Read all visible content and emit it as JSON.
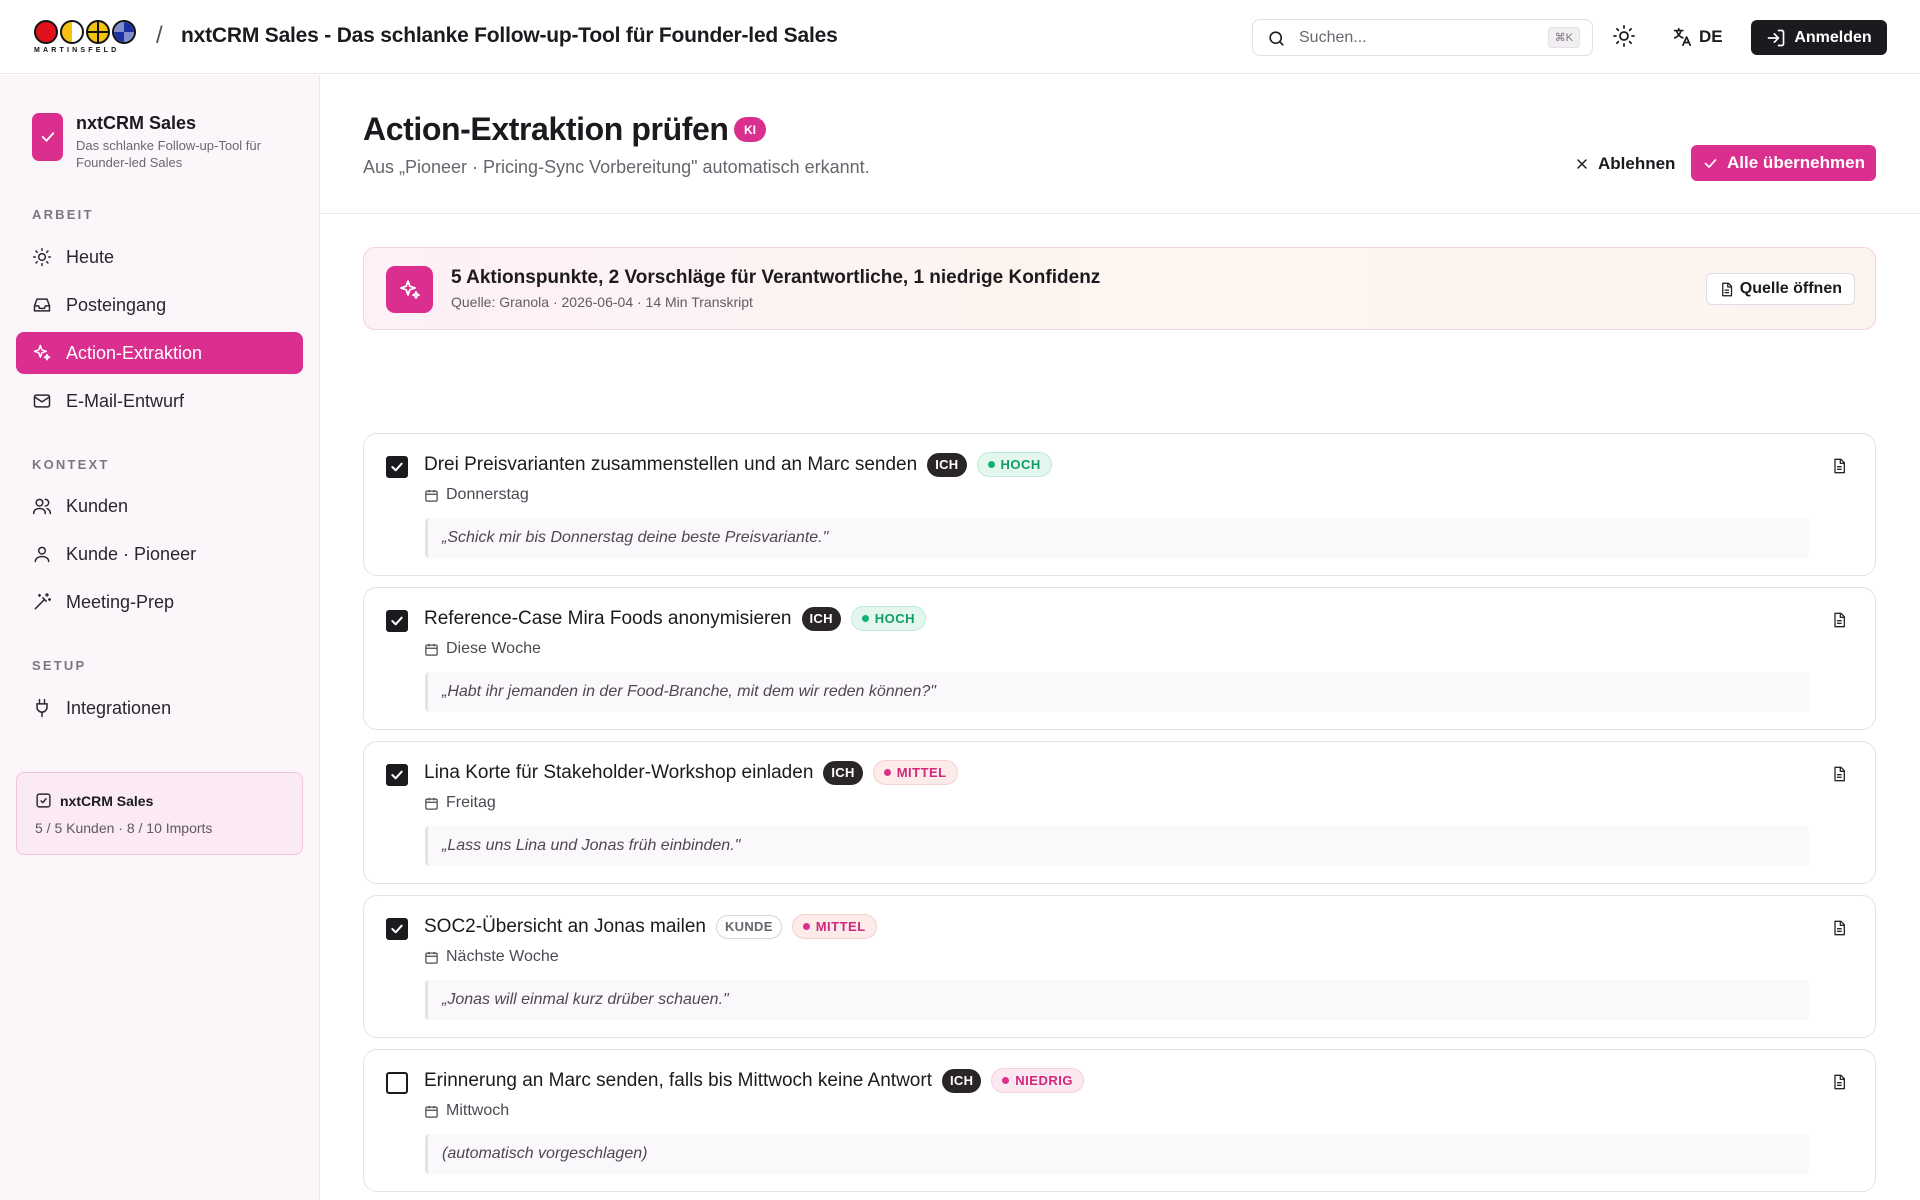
{
  "topbar": {
    "logo_text": "MARTINSFELD",
    "separator": "/",
    "app_title": "nxtCRM Sales - Das schlanke Follow-up-Tool für Founder-led Sales",
    "search_placeholder": "Suchen...",
    "search_shortcut": "⌘K",
    "language": "DE",
    "login_label": "Anmelden"
  },
  "sidebar": {
    "brand_name": "nxtCRM Sales",
    "brand_sub": "Das schlanke Follow-up-Tool für Founder-led Sales",
    "sections": {
      "arbeit": "ARBEIT",
      "kontext": "KONTEXT",
      "setup": "SETUP"
    },
    "items": [
      {
        "label": "Heute",
        "icon": "sun-icon"
      },
      {
        "label": "Posteingang",
        "icon": "inbox-icon"
      },
      {
        "label": "Action-Extraktion",
        "icon": "sparkles-icon",
        "active": true
      },
      {
        "label": "E-Mail-Entwurf",
        "icon": "mail-icon"
      },
      {
        "label": "Kunden",
        "icon": "users-icon"
      },
      {
        "label": "Kunde · Pioneer",
        "icon": "user-icon"
      },
      {
        "label": "Meeting-Prep",
        "icon": "wand-icon"
      },
      {
        "label": "Integrationen",
        "icon": "plug-icon"
      }
    ],
    "plan": {
      "title": "nxtCRM Sales",
      "stats": "5 / 5 Kunden · 8 / 10 Imports"
    }
  },
  "header": {
    "title": "Action-Extraktion prüfen",
    "badge": "KI",
    "subtitle": "Aus „Pioneer · Pricing-Sync Vorbereitung\" automatisch erkannt.",
    "reject_label": "Ablehnen",
    "accept_label": "Alle übernehmen"
  },
  "summary": {
    "title": "5 Aktionspunkte, 2 Vorschläge für Verantwortliche, 1 niedrige Konfidenz",
    "meta": "Quelle: Granola · 2026-06-04 · 14 Min Transkript",
    "source_button": "Quelle öffnen"
  },
  "colors": {
    "accent": "#db2f8f",
    "dark": "#1d1a1f",
    "hoch": "#10b26f"
  },
  "actions": [
    {
      "checked": true,
      "title": "Drei Preisvarianten zusammenstellen und an Marc senden",
      "owner": "ICH",
      "owner_kind": "ich",
      "priority": "HOCH",
      "priority_kind": "hoch",
      "due": "Donnerstag",
      "quote": "„Schick mir bis Donnerstag deine beste Preisvariante.\""
    },
    {
      "checked": true,
      "title": "Reference-Case Mira Foods anonymisieren",
      "owner": "ICH",
      "owner_kind": "ich",
      "priority": "HOCH",
      "priority_kind": "hoch",
      "due": "Diese Woche",
      "quote": "„Habt ihr jemanden in der Food-Branche, mit dem wir reden können?\""
    },
    {
      "checked": true,
      "title": "Lina Korte für Stakeholder-Workshop einladen",
      "owner": "ICH",
      "owner_kind": "ich",
      "priority": "MITTEL",
      "priority_kind": "mittel",
      "due": "Freitag",
      "quote": "„Lass uns Lina und Jonas früh einbinden.\""
    },
    {
      "checked": true,
      "title": "SOC2-Übersicht an Jonas mailen",
      "owner": "KUNDE",
      "owner_kind": "kunde",
      "priority": "MITTEL",
      "priority_kind": "mittel",
      "due": "Nächste Woche",
      "quote": "„Jonas will einmal kurz drüber schauen.\""
    },
    {
      "checked": false,
      "title": "Erinnerung an Marc senden, falls bis Mittwoch keine Antwort",
      "owner": "ICH",
      "owner_kind": "ich",
      "priority": "NIEDRIG",
      "priority_kind": "niedrig",
      "due": "Mittwoch",
      "quote": "(automatisch vorgeschlagen)"
    }
  ]
}
